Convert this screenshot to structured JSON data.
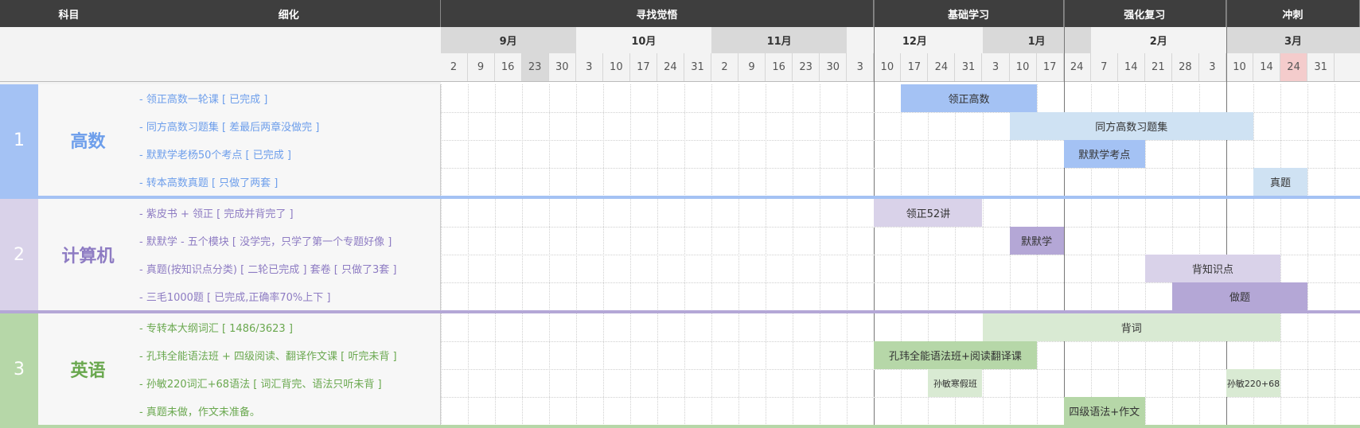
{
  "header": {
    "subject_col": "科目",
    "detail_col": "细化",
    "phases": [
      "寻找觉悟",
      "基础学习",
      "强化复习",
      "冲刺"
    ]
  },
  "months": [
    "9月",
    "10月",
    "11月",
    "12月",
    "1月",
    "2月",
    "3月"
  ],
  "weeks": [
    "2",
    "9",
    "16",
    "23",
    "30",
    "3",
    "10",
    "17",
    "24",
    "31",
    "2",
    "9",
    "16",
    "23",
    "30",
    "3",
    "10",
    "17",
    "24",
    "31",
    "3",
    "10",
    "17",
    "24",
    "7",
    "14",
    "21",
    "28",
    "3",
    "10",
    "14",
    "24",
    "31"
  ],
  "colors": {
    "math_accent": "#a4c2f4",
    "math_text": "#6d9eeb",
    "cs_accent": "#d9d2e9",
    "cs_text": "#8e7cc3",
    "eng_accent": "#b6d7a8",
    "eng_text": "#6aa84f",
    "header_dark": "#3e3e3e"
  },
  "chart_data": {
    "type": "gantt",
    "time_axis": {
      "months": [
        "9月",
        "10月",
        "11月",
        "12月",
        "1月",
        "2月",
        "3月"
      ],
      "week_ticks": [
        "2",
        "9",
        "16",
        "23",
        "30",
        "3",
        "10",
        "17",
        "24",
        "31",
        "2",
        "9",
        "16",
        "23",
        "30",
        "3",
        "10",
        "17",
        "24",
        "31",
        "3",
        "10",
        "17",
        "24",
        "7",
        "14",
        "21",
        "28",
        "3",
        "10",
        "14",
        "24",
        "31"
      ],
      "phases": [
        {
          "name": "寻找觉悟",
          "start": 0,
          "end": 16
        },
        {
          "name": "基础学习",
          "start": 16,
          "end": 23
        },
        {
          "name": "强化复习",
          "start": 23,
          "end": 29
        },
        {
          "name": "冲刺",
          "start": 29,
          "end": 34
        }
      ],
      "highlight_ticks": [
        3,
        31
      ]
    },
    "subjects": [
      {
        "num": "1",
        "name": "高数",
        "tasks": [
          {
            "label": "- 领正高数一轮课 [ 已完成 ]",
            "bar": "领正高数",
            "start": 17,
            "end": 22,
            "shade": "dark"
          },
          {
            "label": "- 同方高数习题集 [ 差最后两章没做完 ]",
            "bar": "同方高数习题集",
            "start": 21,
            "end": 30,
            "shade": "light"
          },
          {
            "label": "- 默默学老杨50个考点 [ 已完成 ]",
            "bar": "默默学考点",
            "start": 23,
            "end": 26,
            "shade": "dark"
          },
          {
            "label": "- 转本高数真题 [ 只做了两套 ]",
            "bar": "真题",
            "start": 30,
            "end": 32,
            "shade": "light"
          }
        ]
      },
      {
        "num": "2",
        "name": "计算机",
        "tasks": [
          {
            "label": "- 紫皮书 + 领正 [ 完成并背完了 ]",
            "bar": "领正52讲",
            "start": 16,
            "end": 20,
            "shade": "light"
          },
          {
            "label": "- 默默学 - 五个模块 [ 没学完，只学了第一个专题好像 ]",
            "bar": "默默学",
            "start": 21,
            "end": 23,
            "shade": "dark"
          },
          {
            "label": "- 真题(按知识点分类) [ 二轮已完成 ]  套卷 [ 只做了3套 ]",
            "bar": "背知识点",
            "start": 26,
            "end": 31,
            "shade": "light"
          },
          {
            "label": "-  三毛1000题 [ 已完成,正确率70%上下 ]",
            "bar": "做题",
            "start": 27,
            "end": 32,
            "shade": "dark"
          }
        ]
      },
      {
        "num": "3",
        "name": "英语",
        "tasks": [
          {
            "label": "-  专转本大纲词汇 [ 1486/3623 ]",
            "bar": "背词",
            "start": 20,
            "end": 31,
            "shade": "light"
          },
          {
            "label": "-  孔玮全能语法班 + 四级阅读、翻译作文课 [ 听完未背 ]",
            "bar": "孔玮全能语法班+阅读翻译课",
            "start": 16,
            "end": 22,
            "shade": "dark"
          },
          {
            "label": "- 孙敏220词汇+68语法 [ 词汇背完、语法只听未背 ]",
            "bar": "孙敏寒假班",
            "bar2": "孙敏220+68",
            "start": 18,
            "end": 20,
            "start2": 29,
            "end2": 31,
            "shade": "light"
          },
          {
            "label": "-  真题未做，作文未准备。",
            "bar": "四级语法+作文",
            "start": 23,
            "end": 26,
            "shade": "dark"
          }
        ]
      }
    ]
  }
}
